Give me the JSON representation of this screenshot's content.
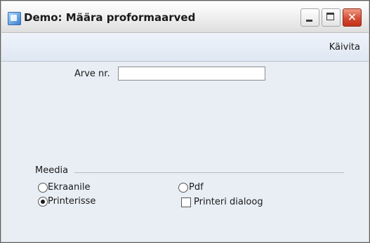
{
  "window": {
    "title": "Demo: Määra proformaarved"
  },
  "titlebar": {
    "min_icon": "minimize-icon",
    "max_icon": "maximize-icon",
    "close_icon": "close-icon",
    "close_glyph": "✕",
    "colors": {
      "close": "#d2472e"
    }
  },
  "toolbar": {
    "run_label": "Käivita"
  },
  "form": {
    "invoice_label": "Arve nr.",
    "invoice_value": ""
  },
  "media": {
    "title": "Meedia",
    "options": [
      {
        "label": "Ekraanile",
        "checked": false
      },
      {
        "label": "Printerisse",
        "checked": true
      },
      {
        "label": "Pdf",
        "checked": false
      }
    ],
    "printer_dialog_label": "Printeri dialoog",
    "printer_dialog_checked": false
  }
}
